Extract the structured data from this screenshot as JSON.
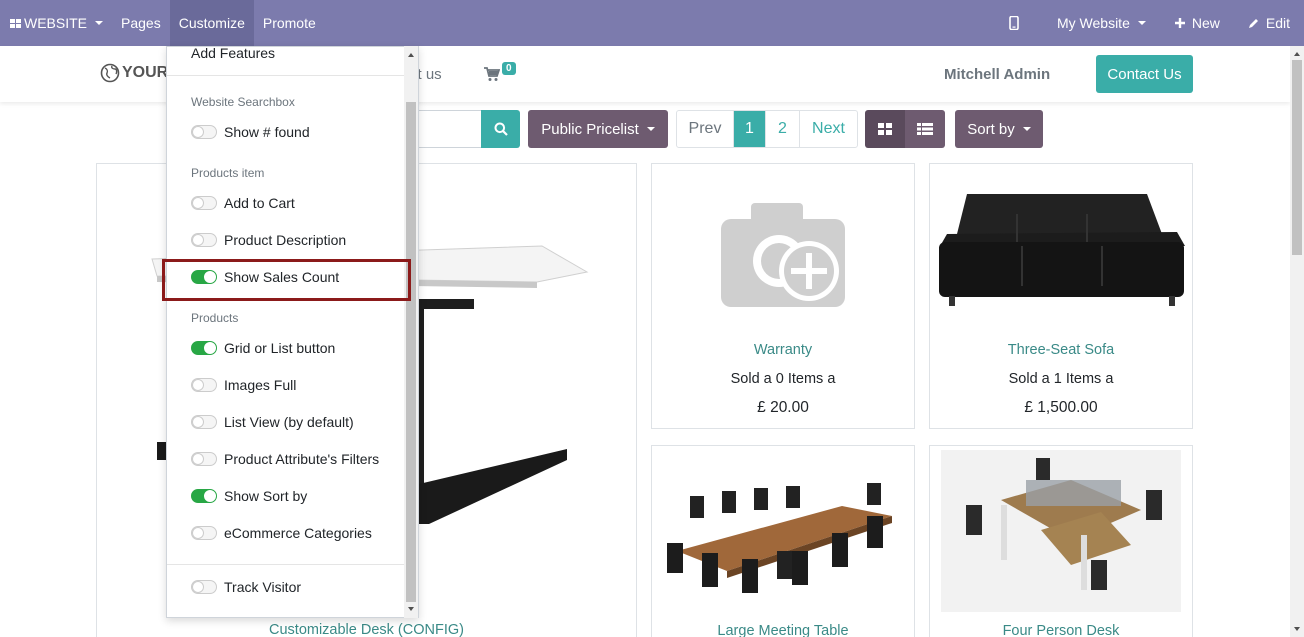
{
  "topbar": {
    "website_label": "WEBSITE",
    "pages_label": "Pages",
    "customize_label": "Customize",
    "promote_label": "Promote",
    "my_website_label": "My Website",
    "new_label": "New",
    "edit_label": "Edit"
  },
  "header": {
    "logo_text": "YOUR",
    "contact_link": "ct us",
    "cart_count": "0",
    "user_name": "Mitchell Admin",
    "contact_button": "Contact Us"
  },
  "toolbar": {
    "pricelist_label": "Public Pricelist",
    "pager": {
      "prev": "Prev",
      "page1": "1",
      "page2": "2",
      "next": "Next"
    },
    "sort_label": "Sort by"
  },
  "customize_menu": {
    "add_features": "Add Features",
    "sections": [
      {
        "header": "Website Searchbox",
        "items": [
          {
            "label": "Show # found",
            "on": false
          }
        ]
      },
      {
        "header": "Products item",
        "items": [
          {
            "label": "Add to Cart",
            "on": false
          },
          {
            "label": "Product Description",
            "on": false
          },
          {
            "label": "Show Sales Count",
            "on": true
          }
        ]
      },
      {
        "header": "Products",
        "items": [
          {
            "label": "Grid or List button",
            "on": true
          },
          {
            "label": "Images Full",
            "on": false
          },
          {
            "label": "List View (by default)",
            "on": false
          },
          {
            "label": "Product Attribute's Filters",
            "on": false
          },
          {
            "label": "Show Sort by",
            "on": true
          },
          {
            "label": "eCommerce Categories",
            "on": false
          }
        ]
      }
    ],
    "track_visitor": {
      "label": "Track Visitor",
      "on": false
    }
  },
  "products": [
    {
      "name": "Customizable Desk (CONFIG)"
    },
    {
      "name": "Warranty",
      "sold": "Sold a 0 Items a",
      "price": "£ 20.00"
    },
    {
      "name": "Three-Seat Sofa",
      "sold": "Sold a 1 Items a",
      "price": "£ 1,500.00"
    },
    {
      "name": "Large Meeting Table"
    },
    {
      "name": "Four Person Desk"
    }
  ],
  "colors": {
    "topbar": "#7c7bad",
    "accent": "#3aada8",
    "secondary": "#6e5b70",
    "toggle_on": "#28a745",
    "highlight": "#8b1a1a"
  }
}
